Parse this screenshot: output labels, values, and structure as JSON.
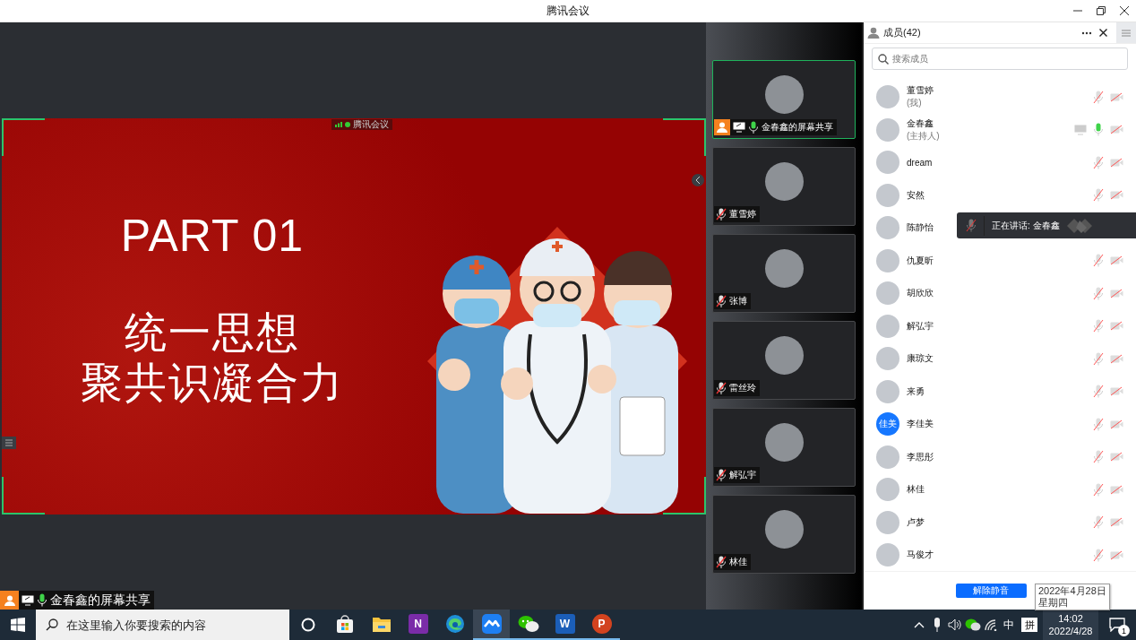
{
  "window": {
    "title": "腾讯会议"
  },
  "slide": {
    "badge": "腾讯会议",
    "heading": "PART 01",
    "lines": [
      "统一思想",
      "聚共识凝合力"
    ]
  },
  "share_label": {
    "name": "金春鑫的屏幕共享",
    "mic_on": true,
    "sharing": true
  },
  "tiles": [
    {
      "name": "金春鑫的屏幕共享",
      "selected": true,
      "mic_on": true,
      "sharing": true
    },
    {
      "name": "董雪婷",
      "selected": false,
      "mic_on": false,
      "sharing": false
    },
    {
      "name": "张博",
      "selected": false,
      "mic_on": false,
      "sharing": false
    },
    {
      "name": "雷丝玲",
      "selected": false,
      "mic_on": false,
      "sharing": false
    },
    {
      "name": "解弘宇",
      "selected": false,
      "mic_on": false,
      "sharing": false
    },
    {
      "name": "林佳",
      "selected": false,
      "mic_on": false,
      "sharing": false
    }
  ],
  "members_panel": {
    "title": "成员(42)",
    "search": {
      "placeholder": "搜索成员"
    },
    "unmute_button": "解除静音"
  },
  "members": [
    {
      "name": "董雪婷",
      "note": "(我)",
      "mic_on": false,
      "video_on": false,
      "sharing": false
    },
    {
      "name": "金春鑫",
      "note": "(主持人)",
      "mic_on": true,
      "video_on": false,
      "sharing": true
    },
    {
      "name": "dream",
      "mic_on": false,
      "video_on": false,
      "sharing": false
    },
    {
      "name": "安然",
      "mic_on": false,
      "video_on": false,
      "sharing": false
    },
    {
      "name": "陈静怡",
      "sharing": false
    },
    {
      "name": "仇夏昕",
      "mic_on": false,
      "video_on": false,
      "sharing": false
    },
    {
      "name": "胡欣欣",
      "mic_on": false,
      "video_on": false,
      "sharing": false
    },
    {
      "name": "解弘宇",
      "mic_on": false,
      "video_on": false,
      "sharing": false
    },
    {
      "name": "康琼文",
      "mic_on": false,
      "video_on": false,
      "sharing": false
    },
    {
      "name": "来勇",
      "mic_on": false,
      "video_on": false,
      "sharing": false
    },
    {
      "name": "李佳美",
      "avatar_text": "佳美",
      "mic_on": false,
      "video_on": false,
      "sharing": false
    },
    {
      "name": "李思彤",
      "mic_on": false,
      "video_on": false,
      "sharing": false
    },
    {
      "name": "林佳",
      "mic_on": false,
      "video_on": false,
      "sharing": false
    },
    {
      "name": "卢梦",
      "mic_on": false,
      "video_on": false,
      "sharing": false
    },
    {
      "name": "马俊才",
      "mic_on": false,
      "video_on": false,
      "sharing": false
    }
  ],
  "speaking_toast": {
    "label": "正在讲话: 金春鑫"
  },
  "date_tooltip": {
    "date": "2022年4月28日",
    "weekday": "星期四"
  },
  "taskbar": {
    "search": {
      "placeholder": "在这里输入你要搜索的内容"
    },
    "apps": [
      {
        "kind": "store",
        "running": false,
        "selected": false
      },
      {
        "kind": "explorer",
        "running": false,
        "selected": false
      },
      {
        "kind": "onenote",
        "glyph": "N",
        "running": false,
        "selected": false
      },
      {
        "kind": "edge",
        "running": false,
        "selected": false
      },
      {
        "kind": "meeting",
        "running": true,
        "selected": true
      },
      {
        "kind": "wechat",
        "running": true,
        "selected": false
      },
      {
        "kind": "word",
        "glyph": "W",
        "running": true,
        "selected": false
      },
      {
        "kind": "powerpoint",
        "glyph": "P",
        "running": true,
        "selected": false
      }
    ],
    "ime_language": "中",
    "ime_mode": "拼",
    "time": "14:02",
    "date": "2022/4/28",
    "notifications": "1"
  }
}
